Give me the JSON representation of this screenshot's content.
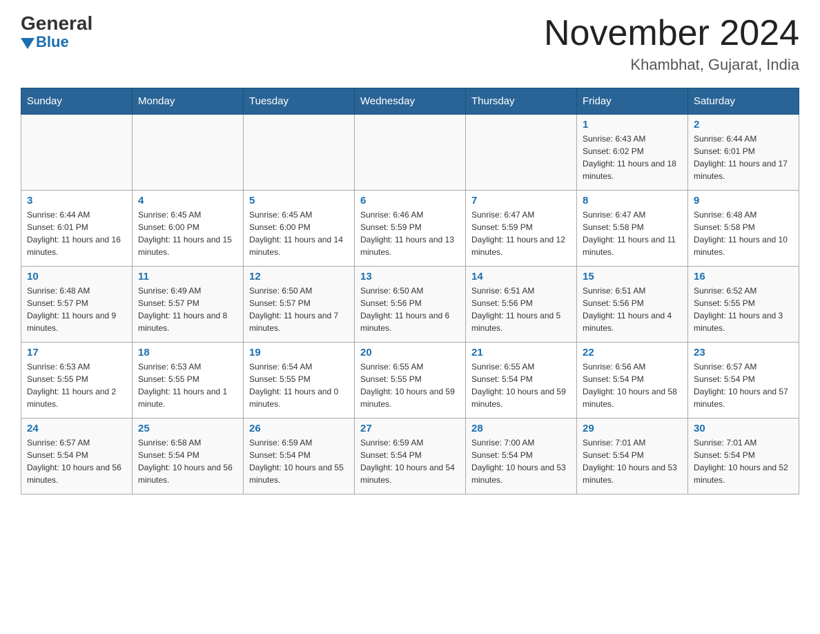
{
  "header": {
    "logo_general": "General",
    "logo_blue": "Blue",
    "month_year": "November 2024",
    "location": "Khambhat, Gujarat, India"
  },
  "weekdays": [
    "Sunday",
    "Monday",
    "Tuesday",
    "Wednesday",
    "Thursday",
    "Friday",
    "Saturday"
  ],
  "weeks": [
    [
      {
        "day": "",
        "sunrise": "",
        "sunset": "",
        "daylight": ""
      },
      {
        "day": "",
        "sunrise": "",
        "sunset": "",
        "daylight": ""
      },
      {
        "day": "",
        "sunrise": "",
        "sunset": "",
        "daylight": ""
      },
      {
        "day": "",
        "sunrise": "",
        "sunset": "",
        "daylight": ""
      },
      {
        "day": "",
        "sunrise": "",
        "sunset": "",
        "daylight": ""
      },
      {
        "day": "1",
        "sunrise": "Sunrise: 6:43 AM",
        "sunset": "Sunset: 6:02 PM",
        "daylight": "Daylight: 11 hours and 18 minutes."
      },
      {
        "day": "2",
        "sunrise": "Sunrise: 6:44 AM",
        "sunset": "Sunset: 6:01 PM",
        "daylight": "Daylight: 11 hours and 17 minutes."
      }
    ],
    [
      {
        "day": "3",
        "sunrise": "Sunrise: 6:44 AM",
        "sunset": "Sunset: 6:01 PM",
        "daylight": "Daylight: 11 hours and 16 minutes."
      },
      {
        "day": "4",
        "sunrise": "Sunrise: 6:45 AM",
        "sunset": "Sunset: 6:00 PM",
        "daylight": "Daylight: 11 hours and 15 minutes."
      },
      {
        "day": "5",
        "sunrise": "Sunrise: 6:45 AM",
        "sunset": "Sunset: 6:00 PM",
        "daylight": "Daylight: 11 hours and 14 minutes."
      },
      {
        "day": "6",
        "sunrise": "Sunrise: 6:46 AM",
        "sunset": "Sunset: 5:59 PM",
        "daylight": "Daylight: 11 hours and 13 minutes."
      },
      {
        "day": "7",
        "sunrise": "Sunrise: 6:47 AM",
        "sunset": "Sunset: 5:59 PM",
        "daylight": "Daylight: 11 hours and 12 minutes."
      },
      {
        "day": "8",
        "sunrise": "Sunrise: 6:47 AM",
        "sunset": "Sunset: 5:58 PM",
        "daylight": "Daylight: 11 hours and 11 minutes."
      },
      {
        "day": "9",
        "sunrise": "Sunrise: 6:48 AM",
        "sunset": "Sunset: 5:58 PM",
        "daylight": "Daylight: 11 hours and 10 minutes."
      }
    ],
    [
      {
        "day": "10",
        "sunrise": "Sunrise: 6:48 AM",
        "sunset": "Sunset: 5:57 PM",
        "daylight": "Daylight: 11 hours and 9 minutes."
      },
      {
        "day": "11",
        "sunrise": "Sunrise: 6:49 AM",
        "sunset": "Sunset: 5:57 PM",
        "daylight": "Daylight: 11 hours and 8 minutes."
      },
      {
        "day": "12",
        "sunrise": "Sunrise: 6:50 AM",
        "sunset": "Sunset: 5:57 PM",
        "daylight": "Daylight: 11 hours and 7 minutes."
      },
      {
        "day": "13",
        "sunrise": "Sunrise: 6:50 AM",
        "sunset": "Sunset: 5:56 PM",
        "daylight": "Daylight: 11 hours and 6 minutes."
      },
      {
        "day": "14",
        "sunrise": "Sunrise: 6:51 AM",
        "sunset": "Sunset: 5:56 PM",
        "daylight": "Daylight: 11 hours and 5 minutes."
      },
      {
        "day": "15",
        "sunrise": "Sunrise: 6:51 AM",
        "sunset": "Sunset: 5:56 PM",
        "daylight": "Daylight: 11 hours and 4 minutes."
      },
      {
        "day": "16",
        "sunrise": "Sunrise: 6:52 AM",
        "sunset": "Sunset: 5:55 PM",
        "daylight": "Daylight: 11 hours and 3 minutes."
      }
    ],
    [
      {
        "day": "17",
        "sunrise": "Sunrise: 6:53 AM",
        "sunset": "Sunset: 5:55 PM",
        "daylight": "Daylight: 11 hours and 2 minutes."
      },
      {
        "day": "18",
        "sunrise": "Sunrise: 6:53 AM",
        "sunset": "Sunset: 5:55 PM",
        "daylight": "Daylight: 11 hours and 1 minute."
      },
      {
        "day": "19",
        "sunrise": "Sunrise: 6:54 AM",
        "sunset": "Sunset: 5:55 PM",
        "daylight": "Daylight: 11 hours and 0 minutes."
      },
      {
        "day": "20",
        "sunrise": "Sunrise: 6:55 AM",
        "sunset": "Sunset: 5:55 PM",
        "daylight": "Daylight: 10 hours and 59 minutes."
      },
      {
        "day": "21",
        "sunrise": "Sunrise: 6:55 AM",
        "sunset": "Sunset: 5:54 PM",
        "daylight": "Daylight: 10 hours and 59 minutes."
      },
      {
        "day": "22",
        "sunrise": "Sunrise: 6:56 AM",
        "sunset": "Sunset: 5:54 PM",
        "daylight": "Daylight: 10 hours and 58 minutes."
      },
      {
        "day": "23",
        "sunrise": "Sunrise: 6:57 AM",
        "sunset": "Sunset: 5:54 PM",
        "daylight": "Daylight: 10 hours and 57 minutes."
      }
    ],
    [
      {
        "day": "24",
        "sunrise": "Sunrise: 6:57 AM",
        "sunset": "Sunset: 5:54 PM",
        "daylight": "Daylight: 10 hours and 56 minutes."
      },
      {
        "day": "25",
        "sunrise": "Sunrise: 6:58 AM",
        "sunset": "Sunset: 5:54 PM",
        "daylight": "Daylight: 10 hours and 56 minutes."
      },
      {
        "day": "26",
        "sunrise": "Sunrise: 6:59 AM",
        "sunset": "Sunset: 5:54 PM",
        "daylight": "Daylight: 10 hours and 55 minutes."
      },
      {
        "day": "27",
        "sunrise": "Sunrise: 6:59 AM",
        "sunset": "Sunset: 5:54 PM",
        "daylight": "Daylight: 10 hours and 54 minutes."
      },
      {
        "day": "28",
        "sunrise": "Sunrise: 7:00 AM",
        "sunset": "Sunset: 5:54 PM",
        "daylight": "Daylight: 10 hours and 53 minutes."
      },
      {
        "day": "29",
        "sunrise": "Sunrise: 7:01 AM",
        "sunset": "Sunset: 5:54 PM",
        "daylight": "Daylight: 10 hours and 53 minutes."
      },
      {
        "day": "30",
        "sunrise": "Sunrise: 7:01 AM",
        "sunset": "Sunset: 5:54 PM",
        "daylight": "Daylight: 10 hours and 52 minutes."
      }
    ]
  ]
}
